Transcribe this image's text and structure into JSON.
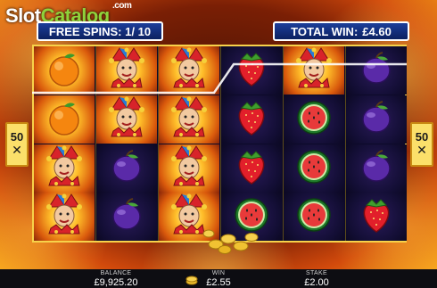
{
  "logo": {
    "part1": "Slot",
    "part2": "Catalog",
    "suffix": ".com"
  },
  "header": {
    "free_spins_label": "FREE SPINS:",
    "free_spins_current": "1",
    "free_spins_separator": "/",
    "free_spins_total": "10",
    "total_win_label": "TOTAL WIN:",
    "total_win_value": "£4.60"
  },
  "side_badges": {
    "left": {
      "value": "50",
      "symbol": "✕"
    },
    "right": {
      "value": "50",
      "symbol": "✕"
    }
  },
  "reels": [
    [
      "orange",
      "orange",
      "jester",
      "jester"
    ],
    [
      "jester",
      "jester",
      "plum",
      "plum"
    ],
    [
      "jester",
      "jester",
      "jester",
      "jester"
    ],
    [
      "strawberry",
      "strawberry",
      "strawberry",
      "watermelon"
    ],
    [
      "jester",
      "watermelon",
      "watermelon",
      "watermelon"
    ],
    [
      "plum",
      "plum",
      "plum",
      "strawberry"
    ]
  ],
  "footer": {
    "balance_label": "BALANCE",
    "balance_value": "£9,925.20",
    "win_label": "WIN",
    "win_value": "£2.55",
    "stake_label": "STAKE",
    "stake_value": "£2.00"
  },
  "colors": {
    "pill_bg": "#1c3e9a",
    "frame_gold": "#f7d24a",
    "logo_green": "#8ed23b",
    "fire_orange": "#d24a0c"
  }
}
